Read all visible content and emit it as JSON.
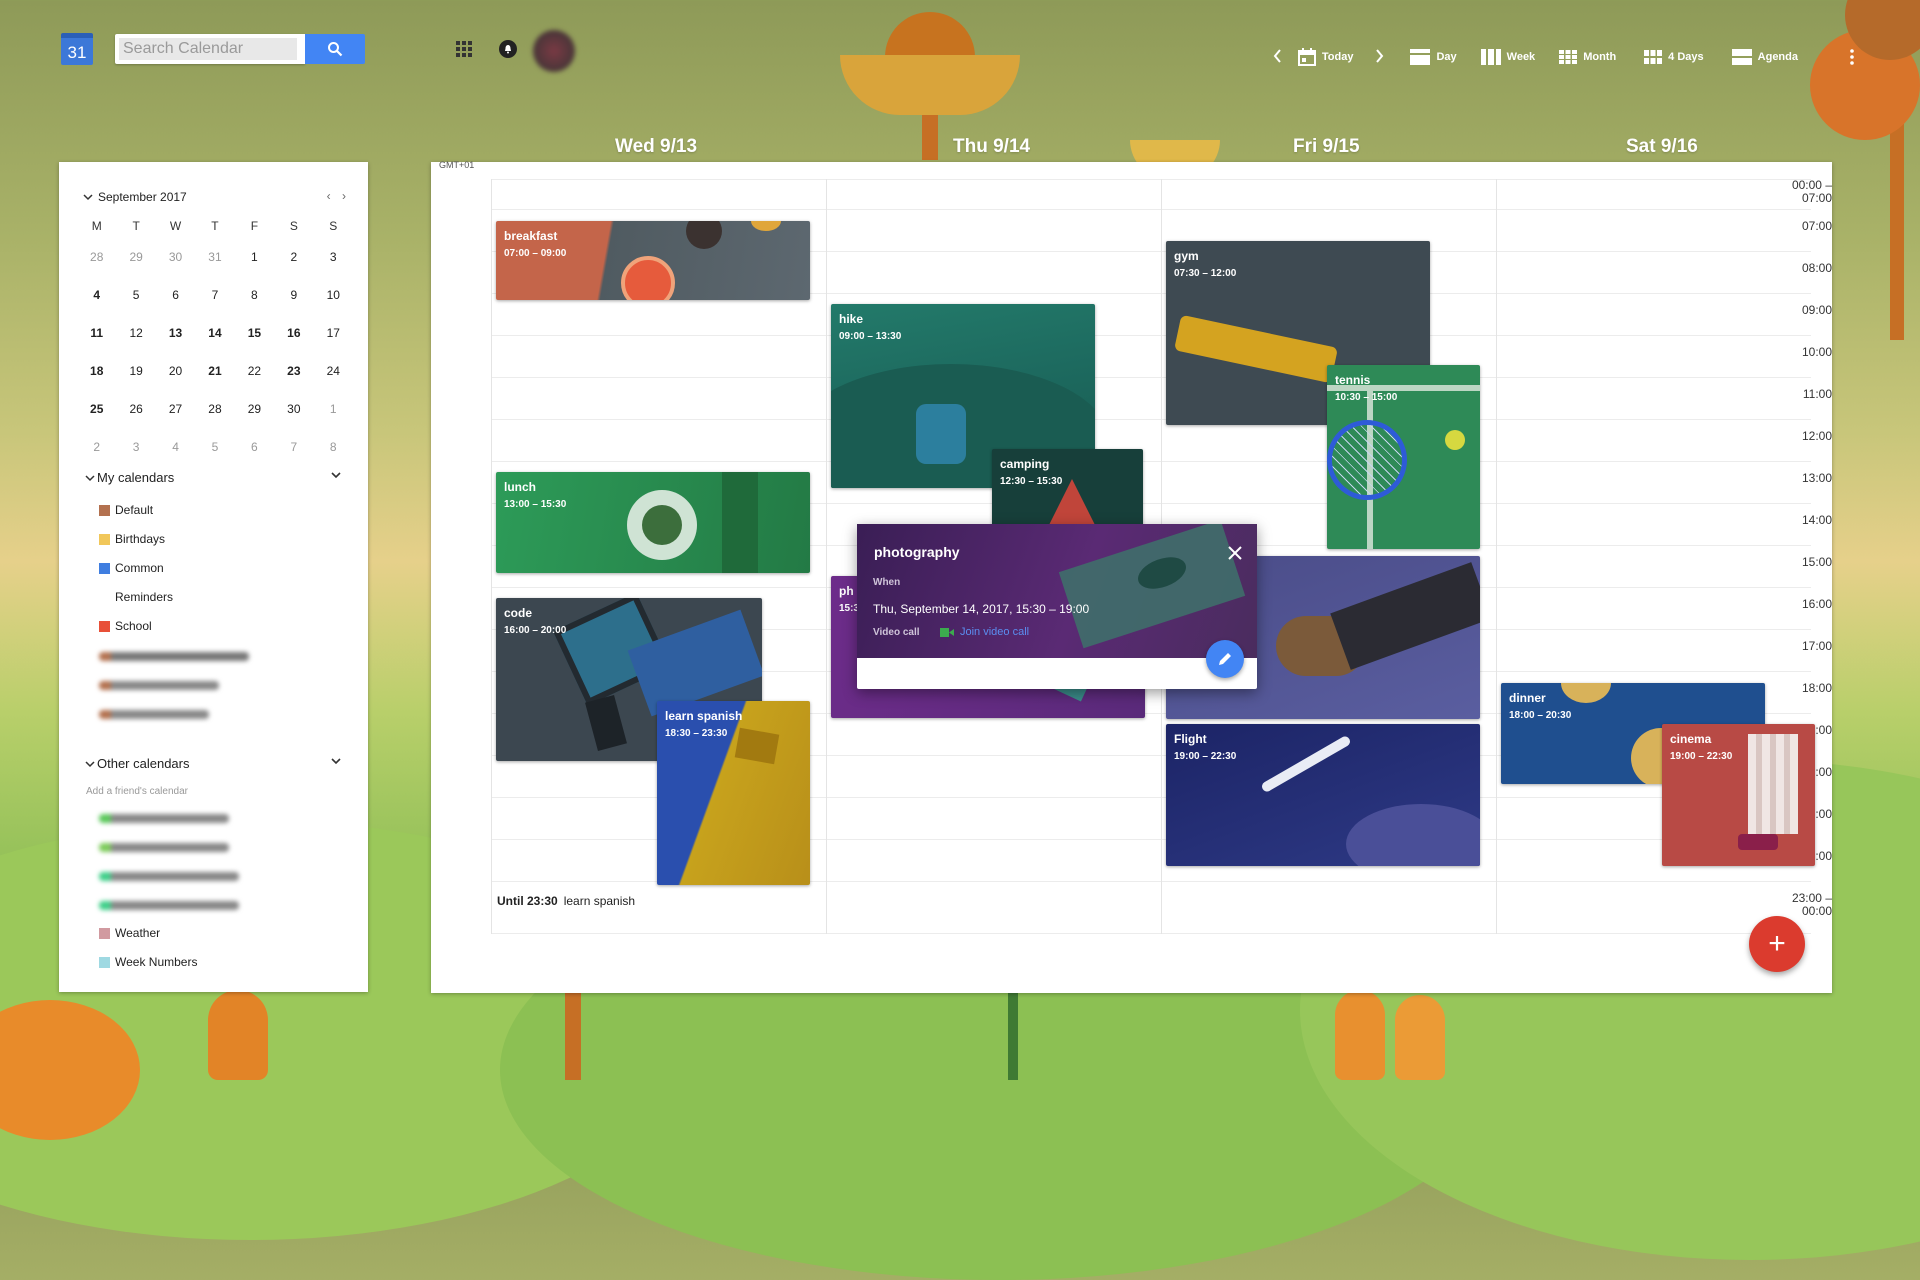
{
  "app": {
    "logo_text": "31",
    "search_placeholder": "Search Calendar"
  },
  "nav": {
    "today": "Today",
    "day": "Day",
    "week": "Week",
    "month": "Month",
    "four_days": "4 Days",
    "agenda": "Agenda"
  },
  "days": [
    "Wed 9/13",
    "Thu 9/14",
    "Fri 9/15",
    "Sat 9/16"
  ],
  "sidebar": {
    "month_label": "September 2017",
    "weekdays": [
      "M",
      "T",
      "W",
      "T",
      "F",
      "S",
      "S"
    ],
    "weeks": [
      [
        "28",
        "29",
        "30",
        "31",
        "1",
        "2",
        "3"
      ],
      [
        "4",
        "5",
        "6",
        "7",
        "8",
        "9",
        "10"
      ],
      [
        "11",
        "12",
        "13",
        "14",
        "15",
        "16",
        "17"
      ],
      [
        "18",
        "19",
        "20",
        "21",
        "22",
        "23",
        "24"
      ],
      [
        "25",
        "26",
        "27",
        "28",
        "29",
        "30",
        "1"
      ],
      [
        "2",
        "3",
        "4",
        "5",
        "6",
        "7",
        "8"
      ]
    ],
    "my_calendars_label": "My calendars",
    "my_calendars": [
      {
        "name": "Default",
        "color": "#b3714f"
      },
      {
        "name": "Birthdays",
        "color": "#f1c75a"
      },
      {
        "name": "Common",
        "color": "#3f7ee0"
      },
      {
        "name": "Reminders",
        "color": ""
      },
      {
        "name": "School",
        "color": "#e85038"
      }
    ],
    "other_calendars_label": "Other calendars",
    "add_friend": "Add a friend's calendar",
    "other_calendars": [
      {
        "name": "Weather",
        "color": "#d19aa0"
      },
      {
        "name": "Week Numbers",
        "color": "#9fd9e2"
      }
    ]
  },
  "grid": {
    "timezone": "GMT+01",
    "before_label": "00:00 –\n07:00",
    "hours": [
      "07:00",
      "08:00",
      "09:00",
      "10:00",
      "11:00",
      "12:00",
      "13:00",
      "14:00",
      "15:00",
      "16:00",
      "17:00",
      "18:00",
      "19:00",
      "20:00",
      "21:00",
      "22:00"
    ],
    "after_label": "23:00 –\n00:00",
    "until_time": "Until 23:30",
    "until_event": "learn spanish"
  },
  "events": {
    "breakfast": {
      "title": "breakfast",
      "time": "07:00 – 09:00",
      "color": "#c4654a"
    },
    "lunch": {
      "title": "lunch",
      "time": "13:00 – 15:30",
      "color": "#2f8a4e"
    },
    "code": {
      "title": "code",
      "time": "16:00 – 20:00",
      "color": "#3b4650"
    },
    "learn_spanish": {
      "title": "learn spanish",
      "time": "18:30 – 23:30",
      "color": "#2b4fa8"
    },
    "hike": {
      "title": "hike",
      "time": "09:00 – 13:30",
      "color": "#1d6a5f"
    },
    "camping": {
      "title": "camping",
      "time": "12:30 – 15:30",
      "color": "#173f3a"
    },
    "photography_stub": {
      "title": "ph",
      "time": "15:3",
      "color": "#6b2c86"
    },
    "gym": {
      "title": "gym",
      "time": "07:30 – 12:00",
      "color": "#3e4a52"
    },
    "tennis": {
      "title": "tennis",
      "time": "10:30 – 15:00",
      "color": "#2e8a57"
    },
    "meeting": {
      "title": "",
      "time": "",
      "color": "#4b4f86"
    },
    "flight": {
      "title": "Flight",
      "time": "19:00 – 22:30",
      "color": "#222a6e"
    },
    "dinner": {
      "title": "dinner",
      "time": "18:00 – 20:30",
      "color": "#1f4f8f"
    },
    "cinema": {
      "title": "cinema",
      "time": "19:00 – 22:30",
      "color": "#b84a45"
    }
  },
  "popup": {
    "title": "photography",
    "when_label": "When",
    "when_value": "Thu, September 14, 2017, 15:30 – 19:00",
    "video_label": "Video call",
    "video_link": "Join video call"
  },
  "fab_label": "+"
}
